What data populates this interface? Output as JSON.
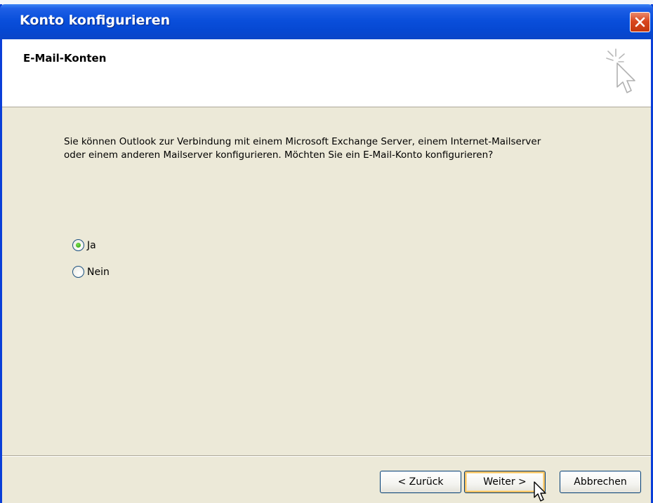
{
  "window": {
    "title": "Konto konfigurieren",
    "close_icon": "close-icon"
  },
  "header": {
    "title": "E-Mail-Konten",
    "icon": "wizard-cursor-icon"
  },
  "body": {
    "message": "Sie können Outlook zur Verbindung mit einem Microsoft Exchange Server, einem Internet-Mailserver oder einem anderen Mailserver konfigurieren. Möchten Sie ein E-Mail-Konto konfigurieren?",
    "options": [
      {
        "label": "Ja",
        "selected": true
      },
      {
        "label": "Nein",
        "selected": false
      }
    ]
  },
  "buttons": {
    "back": "< Zurück",
    "next": "Weiter >",
    "cancel": "Abbrechen"
  },
  "colors": {
    "titlebar": "#0a4fdb",
    "dialog_bg": "#ece9d8",
    "close_button": "#d9471f",
    "radio_dot": "#2a9a0a"
  }
}
